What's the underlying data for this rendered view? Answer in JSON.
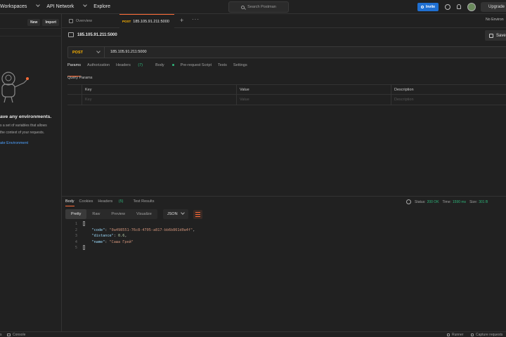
{
  "topbar": {
    "workspaces": "Workspaces",
    "api_network": "API Network",
    "explore": "Explore",
    "search_placeholder": "Search Postman",
    "invite": "Invite",
    "upgrade": "Upgrade"
  },
  "sidebar": {
    "new_label": "New",
    "import_label": "Import",
    "empty_title": "ave any environments.",
    "empty_desc_1": "s a set of variables that allows",
    "empty_desc_2": "the context of your requests.",
    "create_link": "ate Environment"
  },
  "tabs": {
    "overview": "Overview",
    "active_method": "POST",
    "active_url": "185.105.91.211:5000",
    "env_selector": "No Environ"
  },
  "request": {
    "title": "185.105.91.211:5000",
    "save_label": "Save",
    "method": "POST",
    "url": "185.105.91.211:5000",
    "tabs": {
      "params": "Params",
      "authorization": "Authorization",
      "headers": "Headers",
      "headers_count": "(7)",
      "body": "Body",
      "pre_request": "Pre-request Script",
      "tests": "Tests",
      "settings": "Settings"
    },
    "query_params_label": "Query Params",
    "columns": [
      "Key",
      "Value",
      "Description"
    ],
    "placeholders": [
      "Key",
      "Value",
      "Description"
    ]
  },
  "response": {
    "tabs": {
      "body": "Body",
      "cookies": "Cookies",
      "headers": "Headers",
      "headers_count": "(5)",
      "test_results": "Test Results"
    },
    "status_label": "Status:",
    "status_value": "200 OK",
    "time_label": "Time:",
    "time_value": "1590 ms",
    "size_label": "Size:",
    "size_value": "301 B",
    "view_modes": [
      "Pretty",
      "Raw",
      "Preview",
      "Visualize"
    ],
    "format": "JSON",
    "code_lines": {
      "l1": "{",
      "l2_key": "\"code\"",
      "l2_val": "\"0a498551-76c8-4705-a817-bb6b861d0a4f\"",
      "l3_key": "\"distance\"",
      "l3_val": "0.6",
      "l4_key": "\"name\"",
      "l4_val": "\"Саша Грей\"",
      "l5": "}"
    },
    "line_numbers": [
      "1",
      "2",
      "3",
      "4",
      "5"
    ]
  },
  "footer": {
    "left_cut": "s",
    "console": "Console",
    "runner": "Runner",
    "capture": "Capture requests"
  },
  "colors": {
    "accent": "#ff6c37",
    "method_post": "#ffb400",
    "status_ok": "#2fb57a",
    "invite_blue": "#1f6fd1",
    "link_blue": "#4ea1ff"
  }
}
